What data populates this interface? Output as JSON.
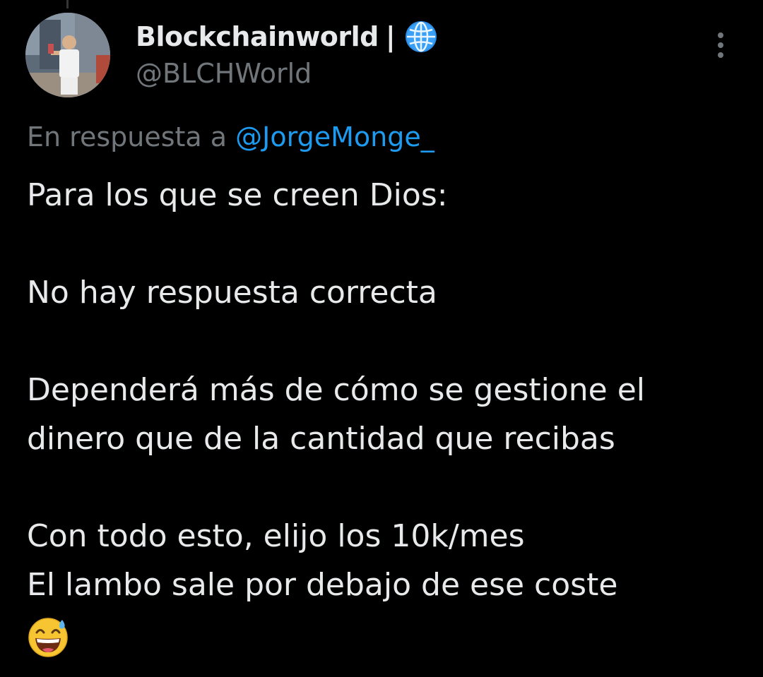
{
  "tweet": {
    "author": {
      "display_name": "Blockchainworld",
      "separator": "|",
      "badge_icon": "globe-icon",
      "handle": "@BLCHWorld"
    },
    "menu_icon": "more-vertical-icon",
    "reply_to": {
      "prefix": "En respuesta a",
      "mention": "@JorgeMonge_"
    },
    "paragraphs": [
      [
        "Para los que se creen Dios:"
      ],
      [
        "No hay respuesta correcta"
      ],
      [
        "Dependerá más de cómo se gestione el",
        "dinero que de la cantidad que recibas"
      ],
      [
        "Con todo esto, elijo los 10k/mes",
        "El lambo sale por debajo de ese coste"
      ]
    ],
    "trailing_emoji": "grinning-face-with-sweat-icon"
  },
  "colors": {
    "background": "#000000",
    "primary_text": "#e7e9ea",
    "secondary_text": "#71767b",
    "link": "#1d9bf0"
  }
}
